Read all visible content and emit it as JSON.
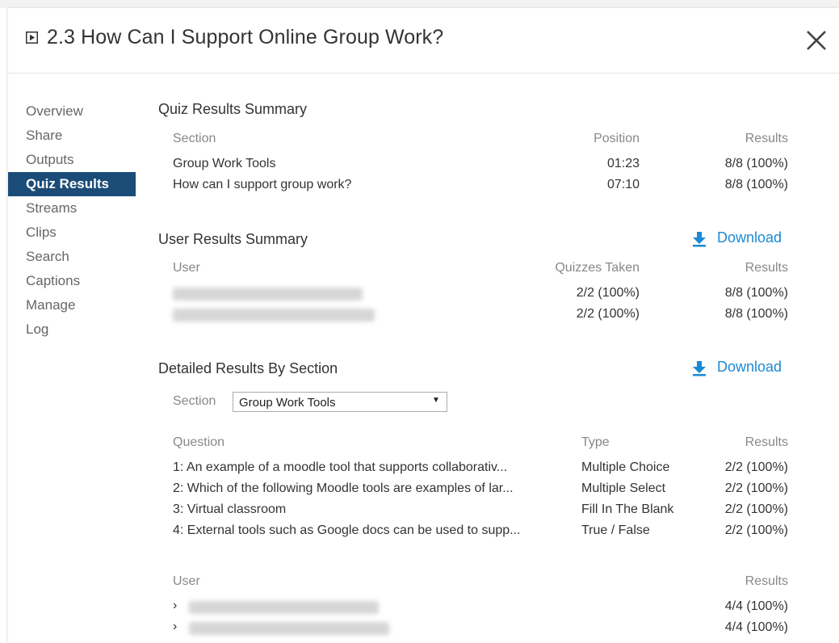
{
  "window": {
    "title": "2.3 How Can I Support Online Group Work?"
  },
  "sidebar": {
    "items": [
      {
        "label": "Overview",
        "active": false
      },
      {
        "label": "Share",
        "active": false
      },
      {
        "label": "Outputs",
        "active": false
      },
      {
        "label": "Quiz Results",
        "active": true
      },
      {
        "label": "Streams",
        "active": false
      },
      {
        "label": "Clips",
        "active": false
      },
      {
        "label": "Search",
        "active": false
      },
      {
        "label": "Captions",
        "active": false
      },
      {
        "label": "Manage",
        "active": false
      },
      {
        "label": "Log",
        "active": false
      }
    ]
  },
  "quiz_summary": {
    "title": "Quiz Results Summary",
    "headers": {
      "section": "Section",
      "position": "Position",
      "results": "Results"
    },
    "rows": [
      {
        "section": "Group Work Tools",
        "position": "01:23",
        "results": "8/8 (100%)"
      },
      {
        "section": "How can I support group work?",
        "position": "07:10",
        "results": "8/8 (100%)"
      }
    ]
  },
  "user_summary": {
    "title": "User Results Summary",
    "download_label": "Download",
    "headers": {
      "user": "User",
      "quizzes": "Quizzes Taken",
      "results": "Results"
    },
    "rows": [
      {
        "quizzes": "2/2 (100%)",
        "results": "8/8 (100%)"
      },
      {
        "quizzes": "2/2 (100%)",
        "results": "8/8 (100%)"
      }
    ]
  },
  "detailed": {
    "title": "Detailed Results By Section",
    "download_label": "Download",
    "section_label": "Section",
    "section_selected": "Group Work Tools",
    "question_headers": {
      "question": "Question",
      "type": "Type",
      "results": "Results"
    },
    "questions": [
      {
        "question": "1: An example of a moodle tool that supports collaborativ...",
        "type": "Multiple Choice",
        "results": "2/2 (100%)"
      },
      {
        "question": "2: Which of the following Moodle tools are examples of lar...",
        "type": "Multiple Select",
        "results": "2/2 (100%)"
      },
      {
        "question": "3: Virtual classroom",
        "type": "Fill In The Blank",
        "results": "2/2 (100%)"
      },
      {
        "question": "4: External tools such as Google docs can be used to supp...",
        "type": "True / False",
        "results": "2/2 (100%)"
      }
    ],
    "user_headers": {
      "user": "User",
      "results": "Results"
    },
    "users": [
      {
        "results": "4/4 (100%)"
      },
      {
        "results": "4/4 (100%)"
      }
    ]
  },
  "colors": {
    "accent": "#1a8ad4",
    "nav_active_bg": "#1b4c78"
  }
}
